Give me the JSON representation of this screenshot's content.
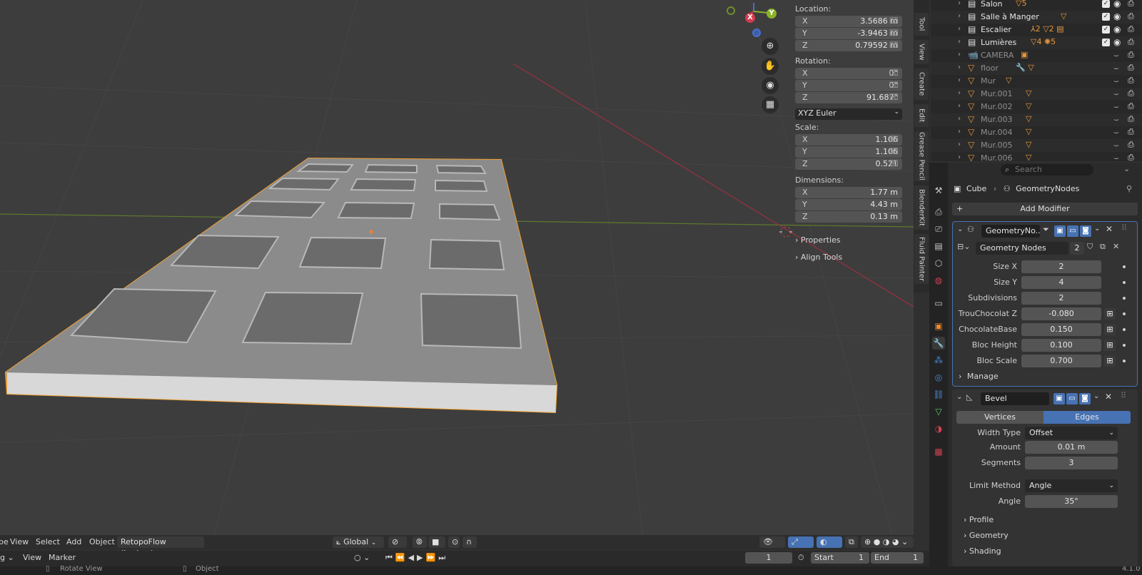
{
  "viewport": {
    "gizmo": {
      "x": "X",
      "y": "Y"
    },
    "npanel": {
      "location_label": "Location:",
      "location": [
        {
          "axis": "X",
          "value": "3.5686 m"
        },
        {
          "axis": "Y",
          "value": "-3.9463 m"
        },
        {
          "axis": "Z",
          "value": "0.79592 m"
        }
      ],
      "rotation_label": "Rotation:",
      "rotation": [
        {
          "axis": "X",
          "value": "0°"
        },
        {
          "axis": "Y",
          "value": "0°"
        },
        {
          "axis": "Z",
          "value": "91.687°"
        }
      ],
      "rotation_mode": "XYZ Euler",
      "scale_label": "Scale:",
      "scale": [
        {
          "axis": "X",
          "value": "1.106"
        },
        {
          "axis": "Y",
          "value": "1.106"
        },
        {
          "axis": "Z",
          "value": "0.521"
        }
      ],
      "dimensions_label": "Dimensions:",
      "dimensions": [
        {
          "axis": "X",
          "value": "1.77 m"
        },
        {
          "axis": "Y",
          "value": "4.43 m"
        },
        {
          "axis": "Z",
          "value": "0.13 m"
        }
      ],
      "properties": "Properties",
      "align_tools": "Align Tools"
    },
    "side_tabs": [
      "Tool",
      "View",
      "Create",
      "Edit",
      "Grease Pencil",
      "BlenderKit",
      "Fluid Painter"
    ],
    "header": {
      "mode_fragment": "be",
      "menus": [
        "View",
        "Select",
        "Add",
        "Object"
      ],
      "addon": "RetopoFlow (broken)",
      "transform": "Global"
    }
  },
  "timeline": {
    "left_fragment": "g",
    "menus": [
      "View",
      "Marker"
    ],
    "current_frame": "1",
    "start_label": "Start",
    "start": "1",
    "end_label": "End",
    "end": "1"
  },
  "statusbar": {
    "rotate": "Rotate View",
    "object": "Object",
    "version": "4.1.0"
  },
  "outliner": {
    "rows": [
      {
        "name": "Salon",
        "type": "collection",
        "extra": "▽5",
        "checked": true
      },
      {
        "name": "Salle à Manger",
        "type": "collection",
        "extra": "▽",
        "checked": true
      },
      {
        "name": "Escalier",
        "type": "collection",
        "extra": "⅄2 ▽2 ▤",
        "checked": true
      },
      {
        "name": "Lumières",
        "type": "collection",
        "extra": "▽4 ✺5",
        "checked": true
      },
      {
        "name": "CAMERA",
        "type": "camera",
        "extra": "▣",
        "checked": false
      },
      {
        "name": "floor",
        "type": "mesh",
        "extra": "🔧 ▽",
        "checked": false
      },
      {
        "name": "Mur",
        "type": "mesh",
        "extra": "▽",
        "checked": false
      },
      {
        "name": "Mur.001",
        "type": "mesh",
        "extra": "▽",
        "checked": false
      },
      {
        "name": "Mur.002",
        "type": "mesh",
        "extra": "▽",
        "checked": false
      },
      {
        "name": "Mur.003",
        "type": "mesh",
        "extra": "▽",
        "checked": false
      },
      {
        "name": "Mur.004",
        "type": "mesh",
        "extra": "▽",
        "checked": false
      },
      {
        "name": "Mur.005",
        "type": "mesh",
        "extra": "▽",
        "checked": false
      },
      {
        "name": "Mur.006",
        "type": "mesh",
        "extra": "▽",
        "checked": false
      }
    ]
  },
  "properties": {
    "search_placeholder": "Search",
    "breadcrumb": {
      "object": "Cube",
      "modifier": "GeometryNodes"
    },
    "add_modifier": "Add Modifier",
    "geo_modifier": {
      "name": "GeometryNo...",
      "node_group": "Geometry Nodes",
      "users": "2",
      "fields": [
        {
          "label": "Size X",
          "value": "2",
          "attr": false
        },
        {
          "label": "Size Y",
          "value": "4",
          "attr": false
        },
        {
          "label": "Subdivisions",
          "value": "2",
          "attr": false
        },
        {
          "label": "TrouChocolat Z",
          "value": "-0.080",
          "attr": true
        },
        {
          "label": "ChocolateBase",
          "value": "0.150",
          "attr": true
        },
        {
          "label": "Bloc Height",
          "value": "0.100",
          "attr": true
        },
        {
          "label": "Bloc Scale",
          "value": "0.700",
          "attr": true
        }
      ],
      "manage": "Manage"
    },
    "bevel_modifier": {
      "name": "Bevel",
      "affect_vertices": "Vertices",
      "affect_edges": "Edges",
      "width_type_label": "Width Type",
      "width_type": "Offset",
      "amount_label": "Amount",
      "amount": "0.01 m",
      "segments_label": "Segments",
      "segments": "3",
      "limit_method_label": "Limit Method",
      "limit_method": "Angle",
      "angle_label": "Angle",
      "angle": "35°",
      "sections": [
        "Profile",
        "Geometry",
        "Shading"
      ]
    }
  },
  "colors": {
    "accent": "#4772b3",
    "selection_outline": "#f0a030",
    "x_axis": "#d43a4e",
    "y_axis": "#8ab32a"
  }
}
